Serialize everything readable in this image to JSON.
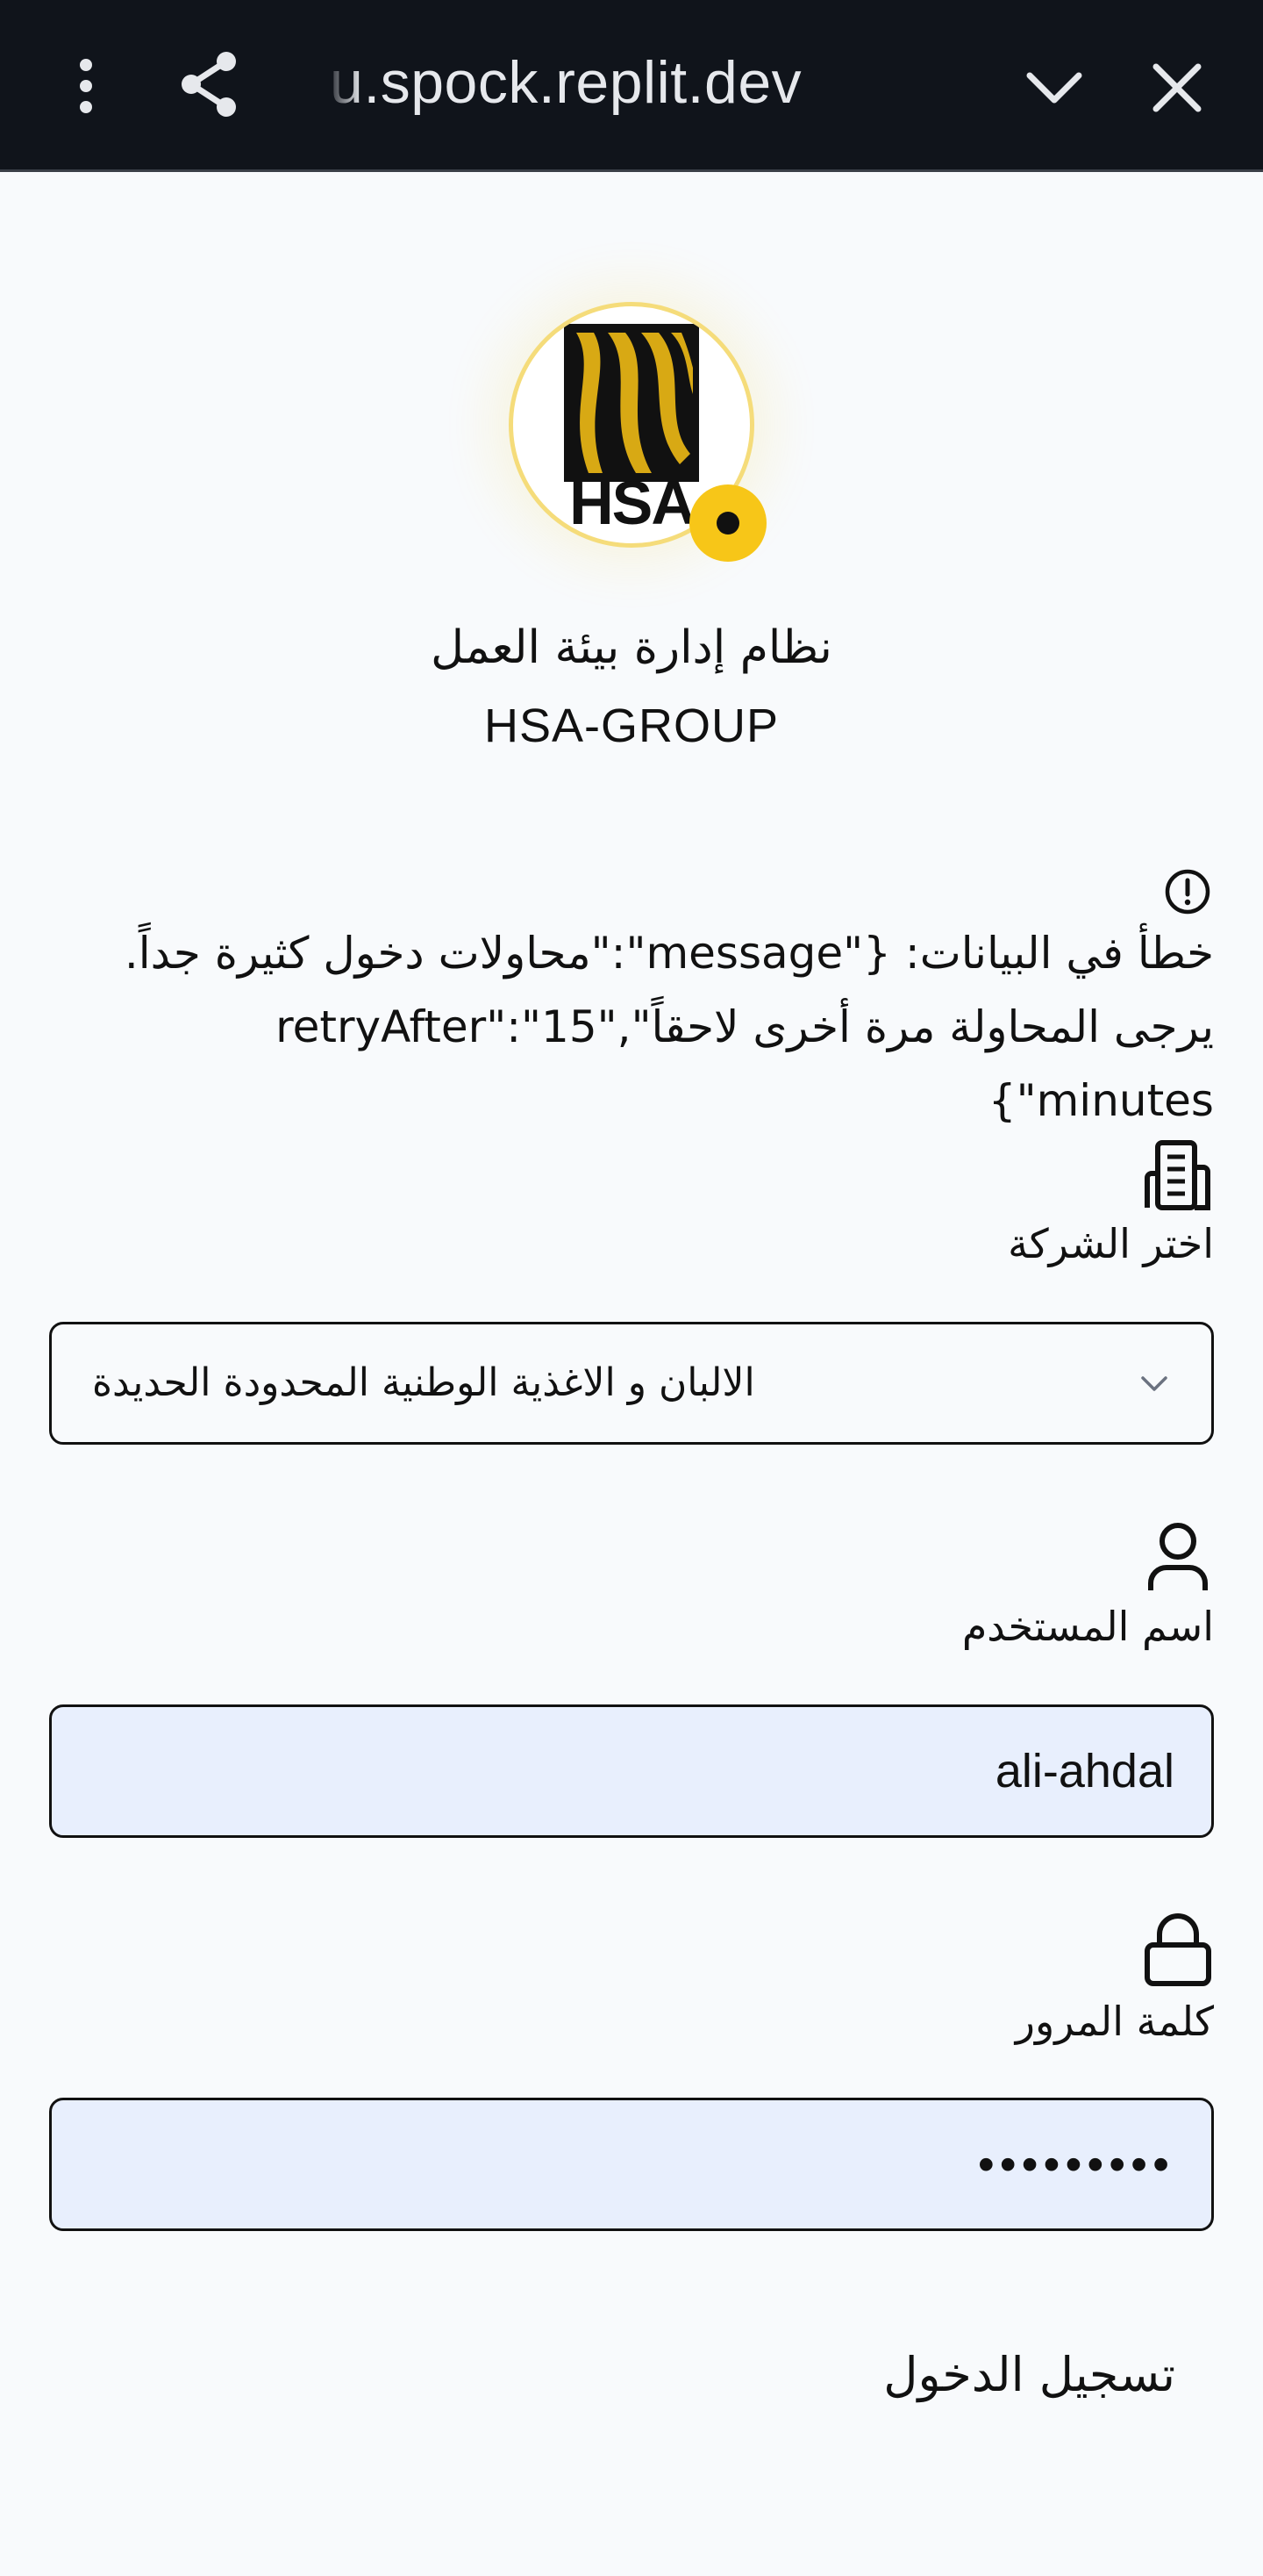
{
  "browser": {
    "url": "u.spock.replit.dev"
  },
  "app": {
    "title": "نظام إدارة بيئة العمل",
    "subtitle": "HSA-GROUP",
    "logo_text": "HSA",
    "brand_color": "#f7c618"
  },
  "error": {
    "message": "خطأ في البيانات: {\"message\":\"محاولات دخول كثيرة جداً. يرجى المحاولة مرة أخرى لاحقاً\",\"retryAfter\":\"15 minutes\"}"
  },
  "form": {
    "company": {
      "label": "اختر الشركة",
      "selected": "الالبان و الاغذية الوطنية المحدودة الحديدة"
    },
    "username": {
      "label": "اسم المستخدم",
      "value": "ali-ahdal"
    },
    "password": {
      "label": "كلمة المرور",
      "value": "•••••••••"
    },
    "submit_label": "تسجيل الدخول"
  },
  "icons": {
    "menu": "more-vertical-icon",
    "share": "share-icon",
    "collapse": "chevron-down-icon",
    "close": "close-icon",
    "error": "alert-circle-icon",
    "company": "building-icon",
    "user": "user-icon",
    "password": "lock-icon"
  }
}
